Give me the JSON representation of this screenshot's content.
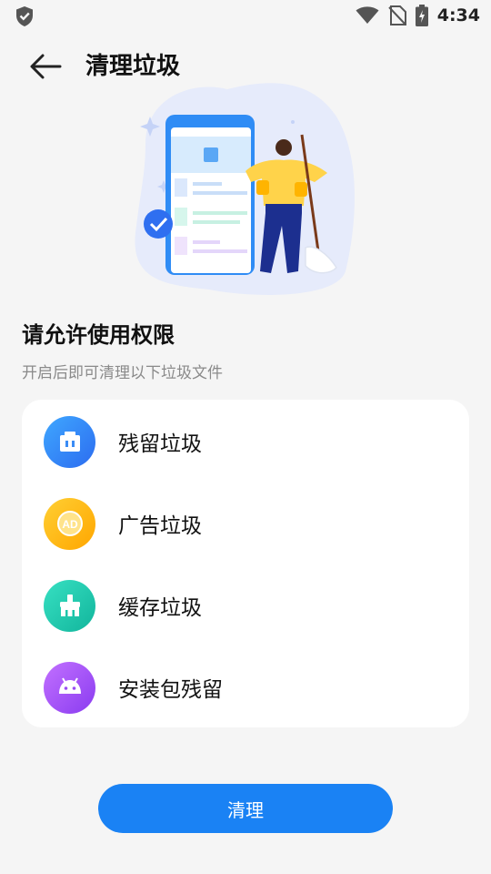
{
  "status_bar": {
    "time": "4:34"
  },
  "header": {
    "title": "清理垃圾"
  },
  "permission": {
    "heading": "请允许使用权限",
    "subtitle": "开启后即可清理以下垃圾文件"
  },
  "items": [
    {
      "label": "残留垃圾",
      "icon": "trash-bin-icon",
      "color": "#2c8cf5"
    },
    {
      "label": "广告垃圾",
      "icon": "ad-icon",
      "color": "#ffb400"
    },
    {
      "label": "缓存垃圾",
      "icon": "broom-icon",
      "color": "#1cc5aa"
    },
    {
      "label": "安装包残留",
      "icon": "android-icon",
      "color": "#a050f5"
    }
  ],
  "actions": {
    "clean_label": "清理"
  },
  "colors": {
    "accent": "#1a82f4",
    "background": "#f5f5f5"
  }
}
